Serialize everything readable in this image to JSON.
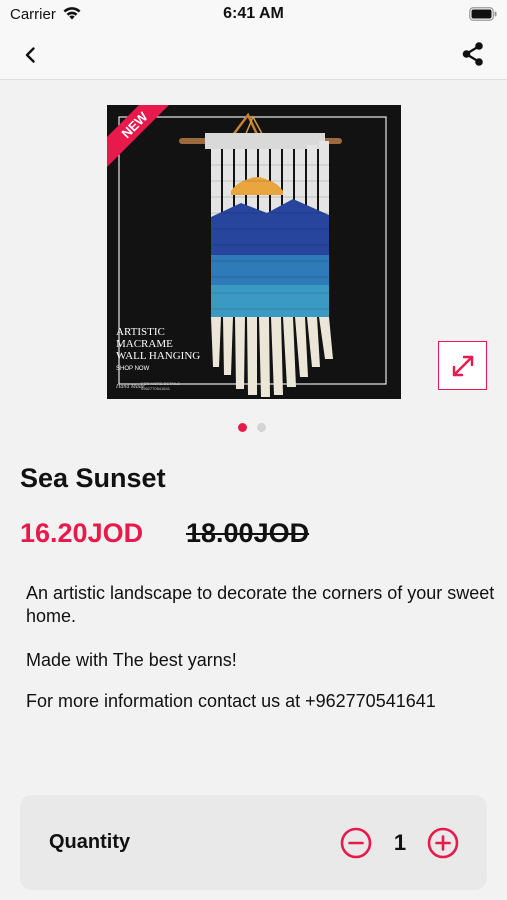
{
  "status_bar": {
    "carrier": "Carrier",
    "time": "6:41 AM"
  },
  "nav": {
    "back_icon": "chevron-left-icon",
    "share_icon": "share-icon"
  },
  "product_image": {
    "badge": "NEW",
    "caption_line1": "ARTISTIC",
    "caption_line2": "MACRAME",
    "caption_line3": "WALL HANGING",
    "caption_cta": "SHOP NOW",
    "footer_text": "FOR MORE DETAILS",
    "footer_phone": "0962770541641"
  },
  "gallery": {
    "total_images": 2,
    "active_index": 0
  },
  "product": {
    "title": "Sea Sunset",
    "price": "16.20JOD",
    "old_price": "18.00JOD",
    "description_1": "An artistic landscape to decorate the corners of your sweet home.",
    "description_2": "Made with The best yarns!",
    "description_3": "For more information contact us at +962770541641"
  },
  "quantity": {
    "label": "Quantity",
    "value": "1"
  },
  "colors": {
    "accent": "#e8194b",
    "background": "#f2f2f2",
    "card": "#e9e9e9"
  }
}
